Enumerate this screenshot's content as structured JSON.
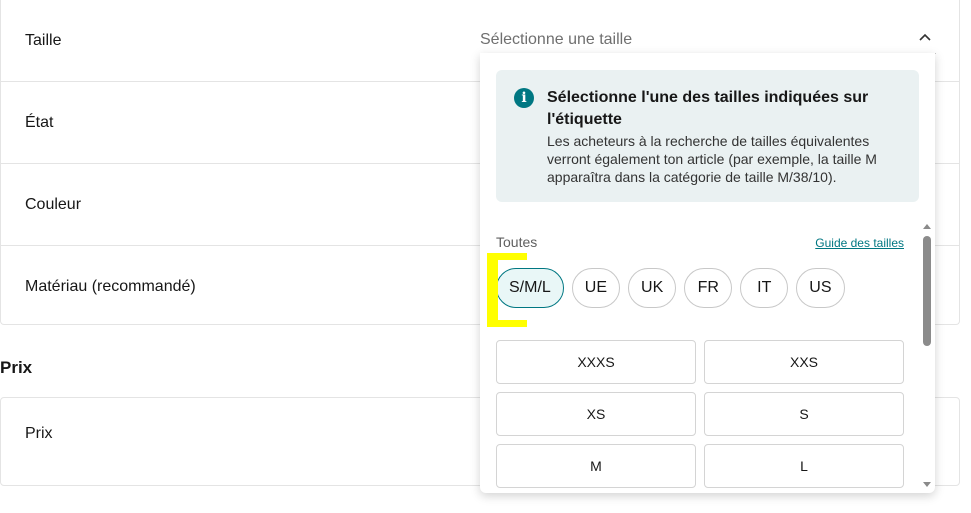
{
  "form": {
    "rows": [
      {
        "label": "Taille"
      },
      {
        "label": "État"
      },
      {
        "label": "Couleur"
      },
      {
        "label": "Matériau (recommandé)"
      }
    ],
    "size_select": {
      "placeholder": "Sélectionne une taille",
      "icon": "chevron-up-icon"
    }
  },
  "price_section": {
    "title": "Prix",
    "field_label": "Prix"
  },
  "size_dropdown": {
    "info": {
      "icon": "info-icon",
      "title": "Sélectionne l'une des tailles indiquées sur l'étiquette",
      "text": "Les acheteurs à la recherche de tailles équivalentes verront également ton article (par exemple, la taille M apparaîtra dans la catégorie de taille M/38/10)."
    },
    "all_label": "Toutes",
    "guide_link": "Guide des tailles",
    "systems": [
      "S/M/L",
      "UE",
      "UK",
      "FR",
      "IT",
      "US"
    ],
    "selected_system": "S/M/L",
    "sizes": [
      "XXXS",
      "XXS",
      "XS",
      "S",
      "M",
      "L"
    ]
  },
  "colors": {
    "accent": "#007782",
    "info_background": "#eaf1f2",
    "highlight": "#ffff00"
  }
}
